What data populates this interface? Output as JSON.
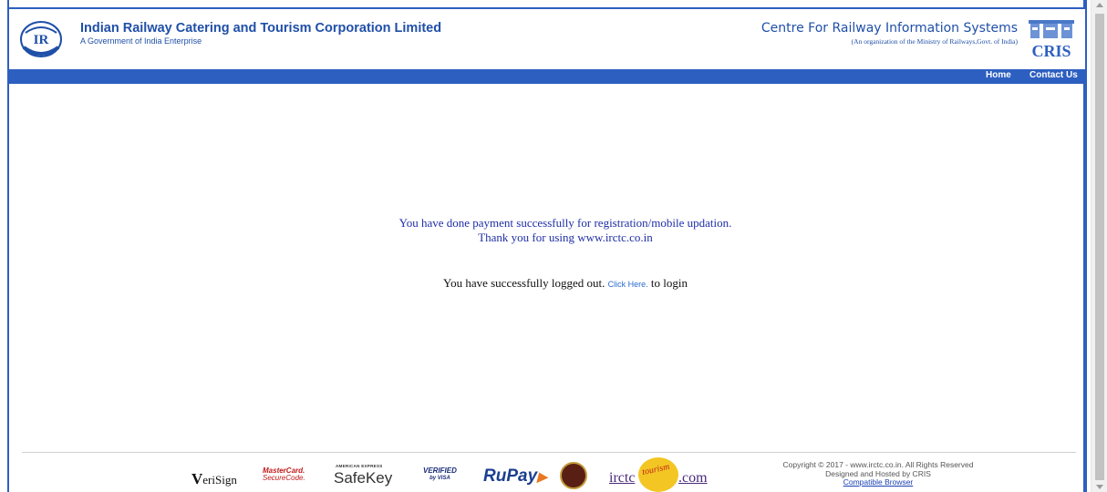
{
  "header": {
    "org_title": "Indian Railway Catering and Tourism Corporation Limited",
    "org_subtitle": "A Government of India Enterprise",
    "cris_title": "Centre For Railway Information Systems",
    "cris_subtitle": "(An organization of the Ministry of Railways,Govt. of India)",
    "cris_logo_text": "CRIS",
    "irctc_logo_text": "IR"
  },
  "nav": {
    "home": "Home",
    "contact": "Contact Us"
  },
  "main": {
    "payment_msg": "You have done payment successfully for registration/mobile updation.",
    "thanks_msg": "Thank you for using www.irctc.co.in",
    "logout_prefix": "You have successfully logged out.",
    "click_here": "Click Here.",
    "logout_suffix": "to login"
  },
  "footer": {
    "badges": {
      "verisign_v": "V",
      "verisign_rest": "eriSign",
      "mastercard_l1": "MasterCard.",
      "mastercard_l2": "SecureCode.",
      "amex": "AMERICAN EXPRESS",
      "safekey": "SafeKey",
      "verified_l1": "VERIFIED",
      "verified_l2": "by VISA",
      "rupay": "RuPay",
      "irctc": "irctc",
      "tourism": "tourism",
      "com": ".com"
    },
    "copyright": "Copyright © 2017 - www.irctc.co.in. All Rights Reserved",
    "designed": "Designed and Hosted by CRIS",
    "compatible": "Compatible Browser"
  },
  "colors": {
    "brand_blue": "#2d5fc0",
    "message_blue": "#1f2fa6"
  }
}
